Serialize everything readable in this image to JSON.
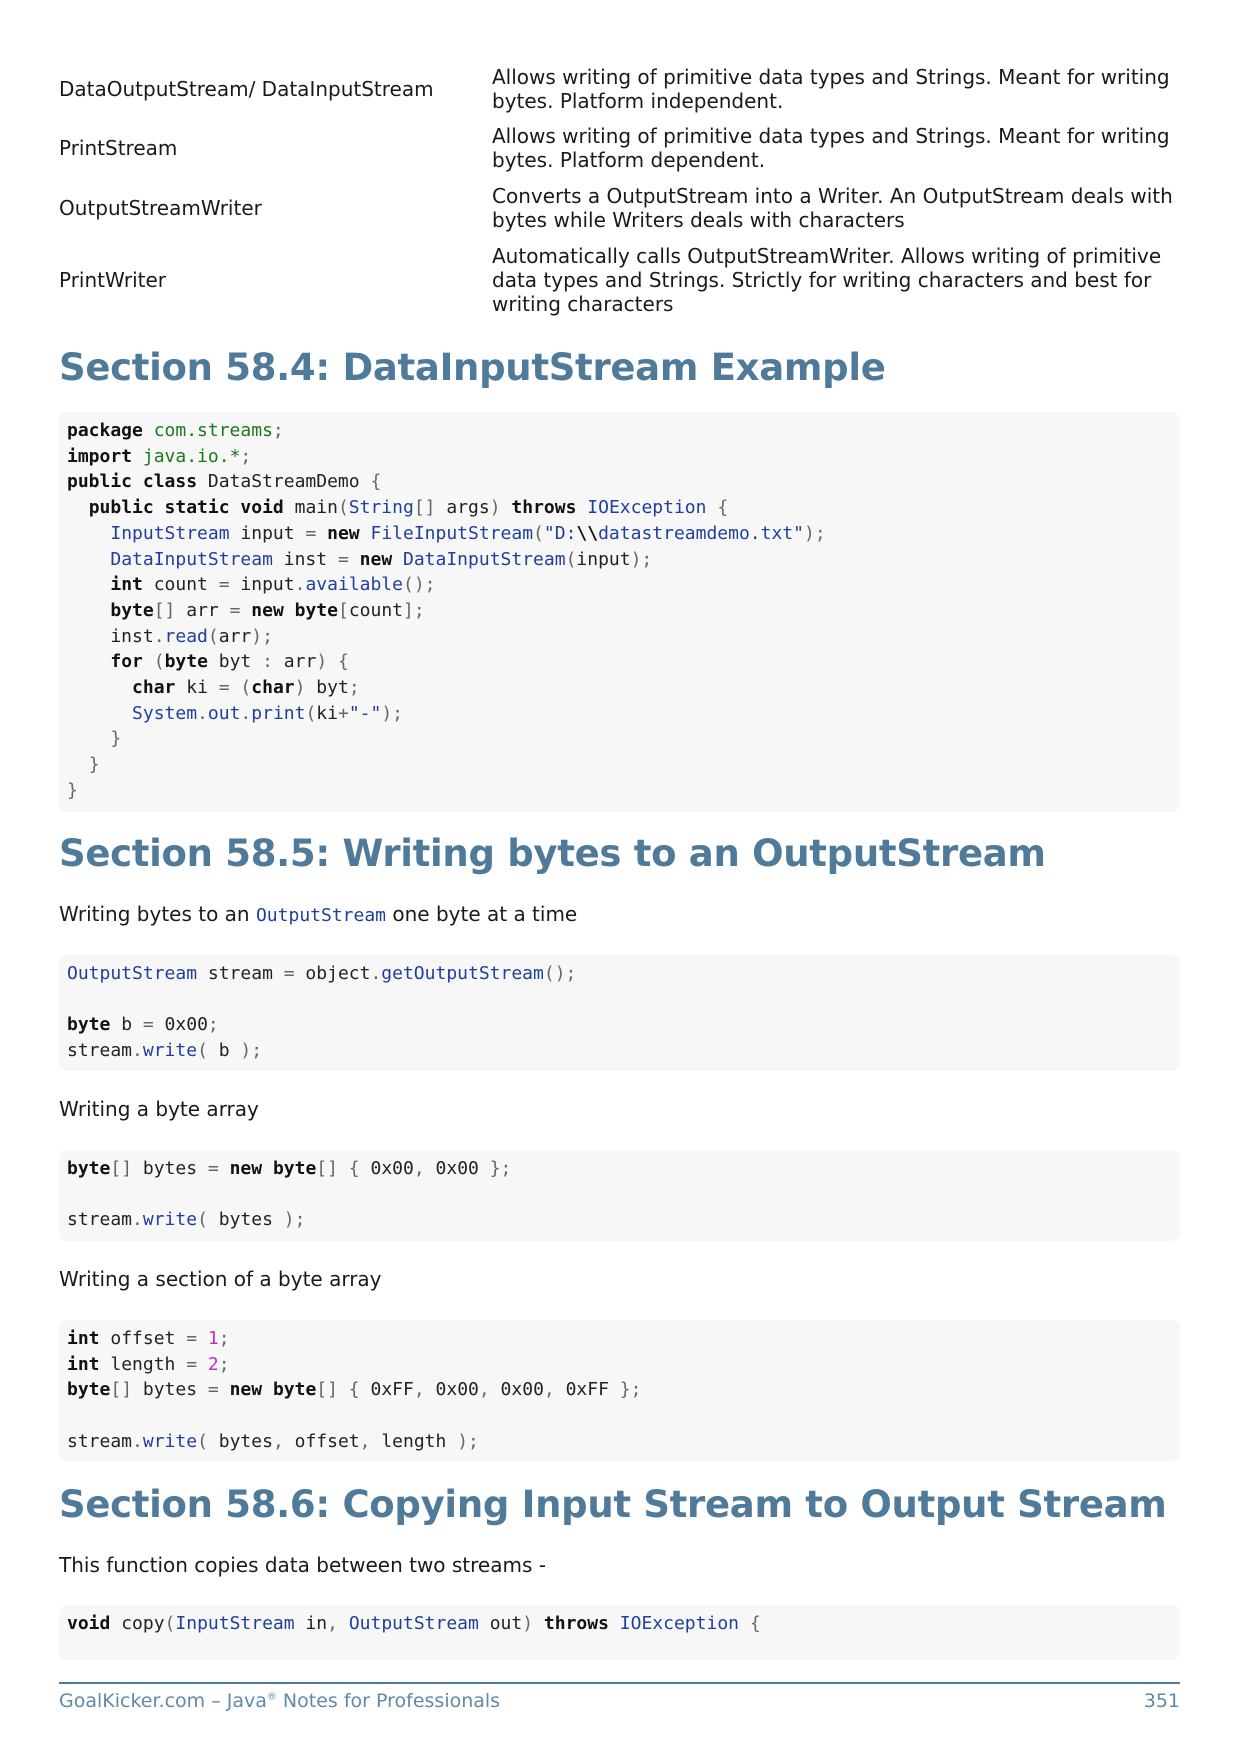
{
  "table": {
    "rows": [
      {
        "name": "DataOutputStream/ DataInputStream",
        "desc": "Allows writing of primitive data types and Strings. Meant for writing bytes. Platform independent."
      },
      {
        "name": "PrintStream",
        "desc": "Allows writing of primitive data types and Strings. Meant for writing bytes. Platform dependent."
      },
      {
        "name": "OutputStreamWriter",
        "desc": "Converts a OutputStream into a Writer. An OutputStream deals with bytes while Writers deals with characters"
      },
      {
        "name": "PrintWriter",
        "desc": "Automatically calls OutputStreamWriter. Allows writing of primitive data types and Strings. Strictly for writing characters and best for writing characters"
      }
    ]
  },
  "sections": {
    "s584": {
      "title": "Section 58.4: DataInputStream Example"
    },
    "s585": {
      "title": "Section 58.5: Writing bytes to an OutputStream",
      "intro_before": "Writing bytes to an ",
      "intro_code": "OutputStream",
      "intro_after": " one byte at a time",
      "para_array": "Writing a byte array",
      "para_section": "Writing a section of a byte array"
    },
    "s586": {
      "title": "Section 58.6: Copying Input Stream to Output Stream",
      "intro": "This function copies data between two streams -"
    }
  },
  "footer": {
    "left_before": "GoalKicker.com – Java",
    "reg": "®",
    "left_after": " Notes for Professionals",
    "page_number": "351"
  }
}
